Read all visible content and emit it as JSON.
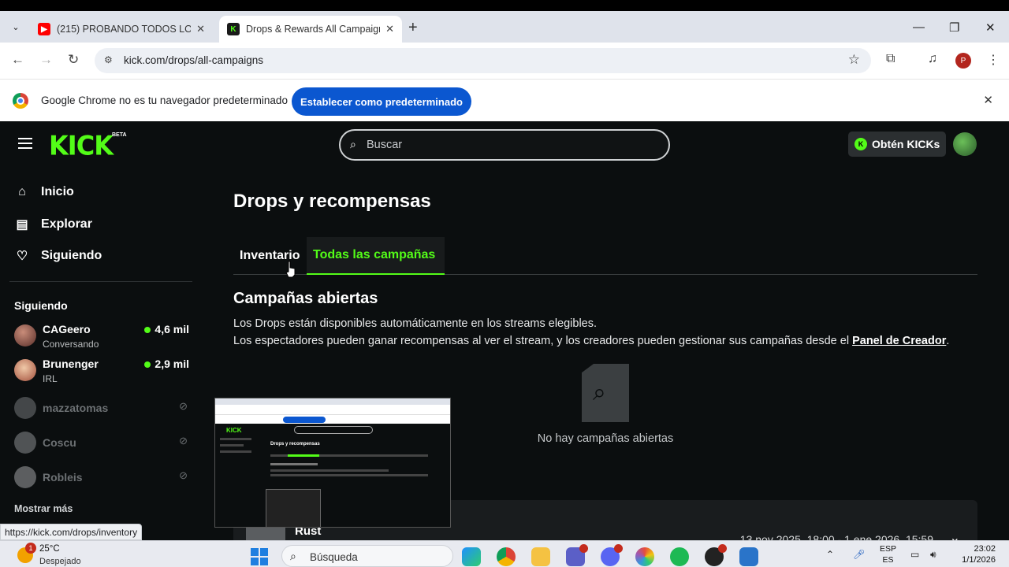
{
  "browser": {
    "tabs": [
      {
        "title": "(215) PROBANDO TODOS LOS",
        "favicon": "youtube-icon",
        "active": false
      },
      {
        "title": "Drops & Rewards All Campaign",
        "favicon": "kick-icon",
        "active": true
      }
    ],
    "url": "kick.com/drops/all-campaigns",
    "profile_initial": "P",
    "infobar_message": "Google Chrome no es tu navegador predeterminado",
    "infobar_button": "Establecer como predeterminado",
    "status_url": "https://kick.com/drops/inventory"
  },
  "kick": {
    "logo": "KICK",
    "beta": "BETA",
    "search_placeholder": "Buscar",
    "kicks_button": "Obtén KICKs",
    "nav": [
      {
        "label": "Inicio",
        "icon": "home-icon"
      },
      {
        "label": "Explorar",
        "icon": "explore-icon"
      },
      {
        "label": "Siguiendo",
        "icon": "heart-icon"
      }
    ],
    "following_heading": "Siguiendo",
    "channels": [
      {
        "name": "CAGeero",
        "subtitle": "Conversando",
        "viewers": "4,6 mil",
        "live": true
      },
      {
        "name": "Brunenger",
        "subtitle": "IRL",
        "viewers": "2,9 mil",
        "live": true
      },
      {
        "name": "mazzatomas",
        "live": false
      },
      {
        "name": "Coscu",
        "live": false
      },
      {
        "name": "Robleis",
        "live": false
      }
    ],
    "show_more": "Mostrar más",
    "page_title": "Drops y recompensas",
    "tabs": [
      "Inventario",
      "Todas las campañas"
    ],
    "active_tab": "Todas las campañas",
    "section_title": "Campañas abiertas",
    "desc_line1": "Los Drops están disponibles automáticamente en los streams elegibles.",
    "desc_line2": "Los espectadores pueden ganar recompensas al ver el stream, y los creadores pueden gestionar sus campañas desde el",
    "creator_link": "Panel de Creador",
    "empty_text": "No hay campañas abiertas",
    "campaign": {
      "game": "Rust",
      "dates": "13 nov 2025, 18:00 - 1 ene 2026, 15:59"
    },
    "accent": "#53fc18"
  },
  "taskbar": {
    "temperature": "25°C",
    "condition": "Despejado",
    "weather_badge": "1",
    "search_label": "Búsqueda",
    "lang_top": "ESP",
    "lang_bottom": "ES",
    "time": "23:02",
    "date": "1/1/2026"
  }
}
